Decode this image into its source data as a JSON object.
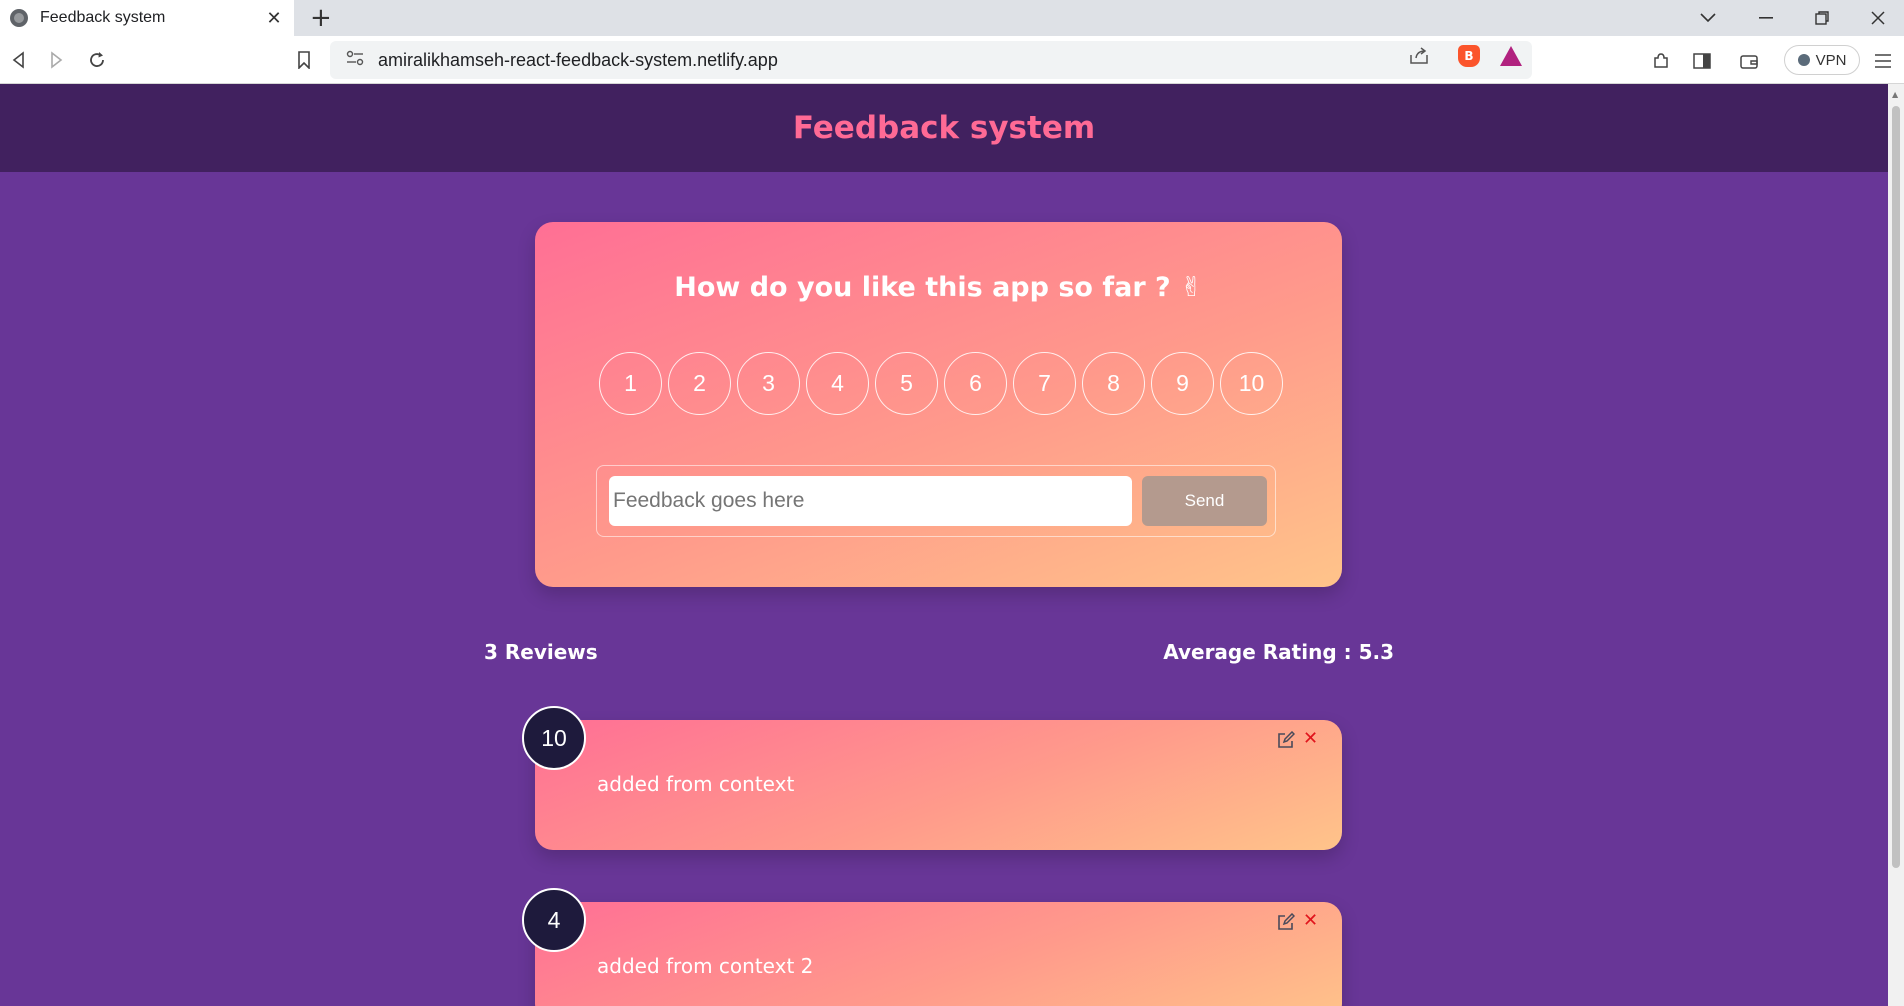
{
  "browser": {
    "tab_title": "Feedback system",
    "tab_close": "✕",
    "new_tab": "+",
    "url": "amiralikhamseh-react-feedback-system.netlify.app",
    "vpn_label": "VPN"
  },
  "page": {
    "title": "Feedback system",
    "question": "How do you like this app so far ? ✌",
    "ratings": [
      "1",
      "2",
      "3",
      "4",
      "5",
      "6",
      "7",
      "8",
      "9",
      "10"
    ],
    "input_placeholder": "Feedback goes here",
    "send_label": "Send",
    "reviews_count": "3 Reviews",
    "average_rating": "Average Rating : 5.3"
  },
  "reviews": [
    {
      "rating": "10",
      "text": "added from context"
    },
    {
      "rating": "4",
      "text": "added from context 2"
    }
  ],
  "icons": {
    "delete": "✕"
  },
  "colors": {
    "background": "#683697",
    "header": "#41215f",
    "title": "#ff6a95",
    "badge": "#1e1a3c",
    "send_button": "#b49a8e",
    "delete_icon": "#e0141c"
  }
}
